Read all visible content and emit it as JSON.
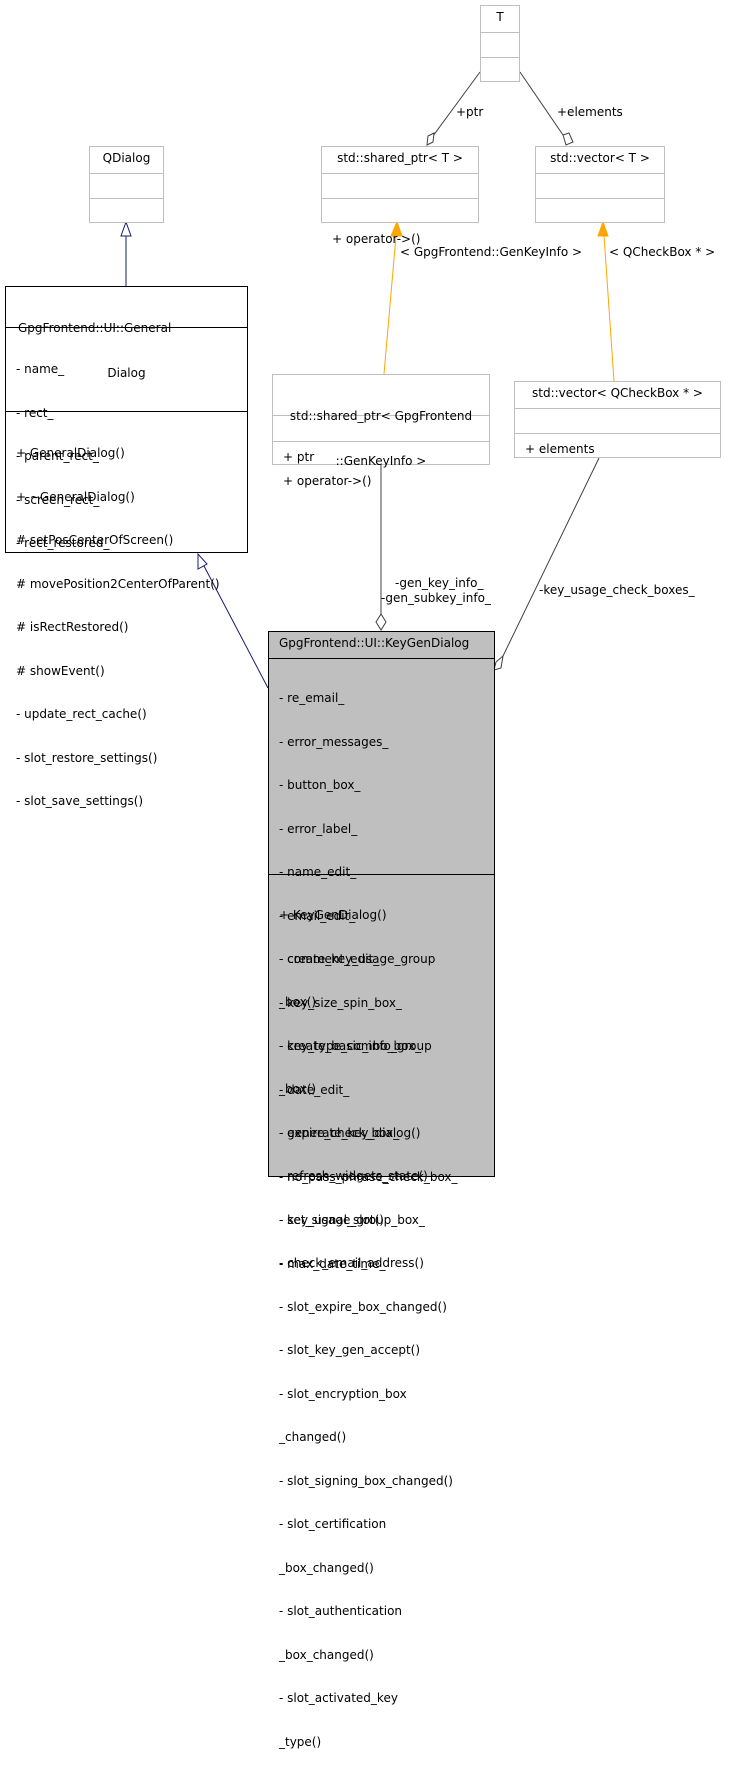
{
  "classes": {
    "T": {
      "name": "T",
      "attributes": [],
      "methods": []
    },
    "shared_ptr_T": {
      "name": "std::shared_ptr< T >",
      "attributes": [],
      "methods": [
        "+ operator->()"
      ]
    },
    "vector_T": {
      "name": "std::vector< T >",
      "attributes": [],
      "methods": []
    },
    "qdialog": {
      "name": "QDialog",
      "attributes": [],
      "methods": []
    },
    "general_dialog": {
      "name_line1": "GpgFrontend::UI::General",
      "name_line2": "Dialog",
      "attributes": [
        "- name_",
        "- rect_",
        "- parent_rect_",
        "- screen_rect_",
        "- rect_restored_"
      ],
      "methods": [
        "+ GeneralDialog()",
        "+ ~GeneralDialog()",
        "# setPosCenterOfScreen()",
        "# movePosition2CenterOfParent()",
        "# isRectRestored()",
        "# showEvent()",
        "- update_rect_cache()",
        "- slot_restore_settings()",
        "- slot_save_settings()"
      ]
    },
    "shared_ptr_genkeyinfo": {
      "name_line1": "std::shared_ptr< GpgFrontend",
      "name_line2": "::GenKeyInfo >",
      "attributes": [
        "+ ptr"
      ],
      "methods": [
        "+ operator->()"
      ]
    },
    "vector_qcheckbox": {
      "name": "std::vector< QCheckBox * >",
      "attributes": [
        "+ elements"
      ],
      "methods": []
    },
    "keygen_dialog": {
      "name": "GpgFrontend::UI::KeyGenDialog",
      "attributes": [
        "- re_email_",
        "- error_messages_",
        "- button_box_",
        "- error_label_",
        "- name_edit_",
        "- email_edit_",
        "- comment_edit_",
        "- key_size_spin_box_",
        "- key_type_combo_box_",
        "- date_edit_",
        "- expire_check_box_",
        "- no_pass_phrase_check_box_",
        "- key_usage_group_box_",
        "- max_date_time_"
      ],
      "methods": [
        "+ KeyGenDialog()",
        "- create_key_usage_group",
        "_box()",
        "- create_basic_info_group",
        "_box()",
        "- generate_key_dialog()",
        "- refresh_widgets_state()",
        "- set_signal_slot()",
        "- check_email_address()",
        "- slot_expire_box_changed()",
        "- slot_key_gen_accept()",
        "- slot_encryption_box",
        "_changed()",
        "- slot_signing_box_changed()",
        "- slot_certification",
        "_box_changed()",
        "- slot_authentication",
        "_box_changed()",
        "- slot_activated_key",
        "_type()"
      ]
    }
  },
  "edge_labels": {
    "ptr": "+ptr",
    "elements": "+elements",
    "genkeyinfo_template": "< GpgFrontend::GenKeyInfo >",
    "qcheckbox_template": "< QCheckBox * >",
    "gen_key_info": "-gen_key_info_",
    "gen_subkey_info": "-gen_subkey_info_",
    "key_usage_check_boxes": "-key_usage_check_boxes_"
  },
  "colors": {
    "inheritance": "#191970",
    "template": "#ffa500",
    "association": "#404040",
    "main_fill": "#bfbfbf",
    "gray_border": "#bfbfbf"
  }
}
